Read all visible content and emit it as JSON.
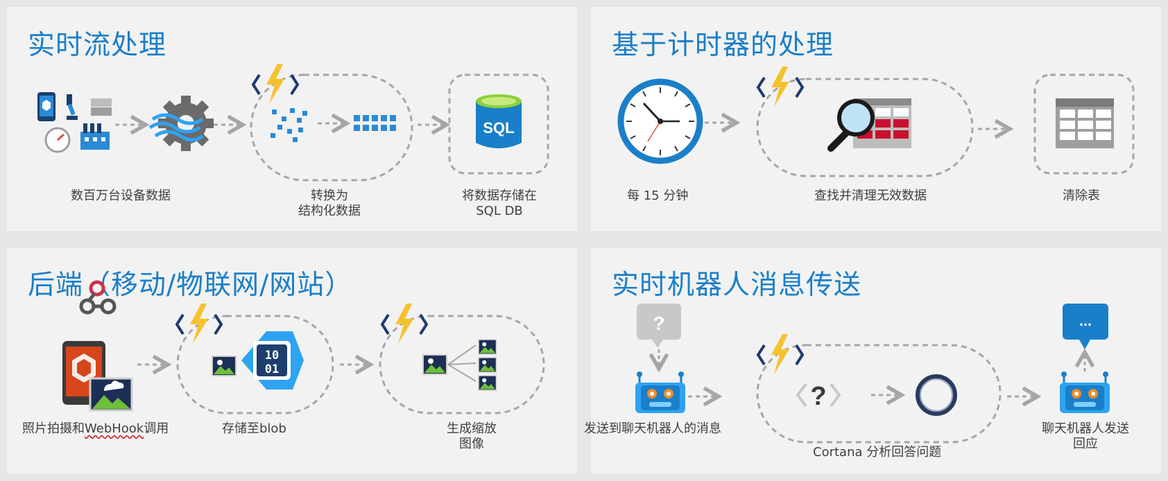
{
  "colors": {
    "title": "#1a7fc9",
    "arrow": "#a6a6a6",
    "bolt": "#f5c22e",
    "bracket": "#1e3a6e",
    "azure": "#2a8ad6",
    "panel": "#f2f2f2",
    "background": "#e6e6e6"
  },
  "panels": {
    "stream": {
      "title": "实时流处理",
      "cap_devices": "数百万台设备数据",
      "cap_transform_1": "转换为",
      "cap_transform_2": "结构化数据",
      "cap_store_1": "将数据存储在",
      "cap_store_2": "SQL DB",
      "sql_label": "SQL"
    },
    "timer": {
      "title": "基于计时器的处理",
      "cap_clock": "每 15 分钟",
      "cap_find": "查找并清理无效数据",
      "cap_clean": "清除表"
    },
    "backend": {
      "title": "后端（移动/物联网/网站）",
      "cap_photo_prefix": "照片拍摄和",
      "cap_photo_word": "WebHook",
      "cap_photo_suffix": "调用",
      "cap_blob": "存储至blob",
      "cap_thumb_1": "生成缩放",
      "cap_thumb_2": "图像",
      "blob_digits_1": "10",
      "blob_digits_2": "01"
    },
    "bot": {
      "title": "实时机器人消息传送",
      "cap_send": "发送到聊天机器人的消息",
      "cap_cortana": "Cortana 分析回答问题",
      "cap_reply_1": "聊天机器人发送",
      "cap_reply_2": "回应",
      "question_mark": "?",
      "reply_dots": "..."
    }
  },
  "icons": [
    "phone-icon",
    "robot-arm-icon",
    "server-icon",
    "gauge-icon",
    "factory-icon",
    "gear-waves-icon",
    "function-bolt-icon",
    "data-points-icon",
    "sql-database-icon",
    "clock-icon",
    "search-table-icon",
    "table-icon",
    "webhook-icon",
    "mobile-photo-icon",
    "blob-storage-icon",
    "image-icon",
    "bot-icon",
    "question-bubble-icon",
    "cortana-ring-icon",
    "chat-bubble-icon"
  ]
}
